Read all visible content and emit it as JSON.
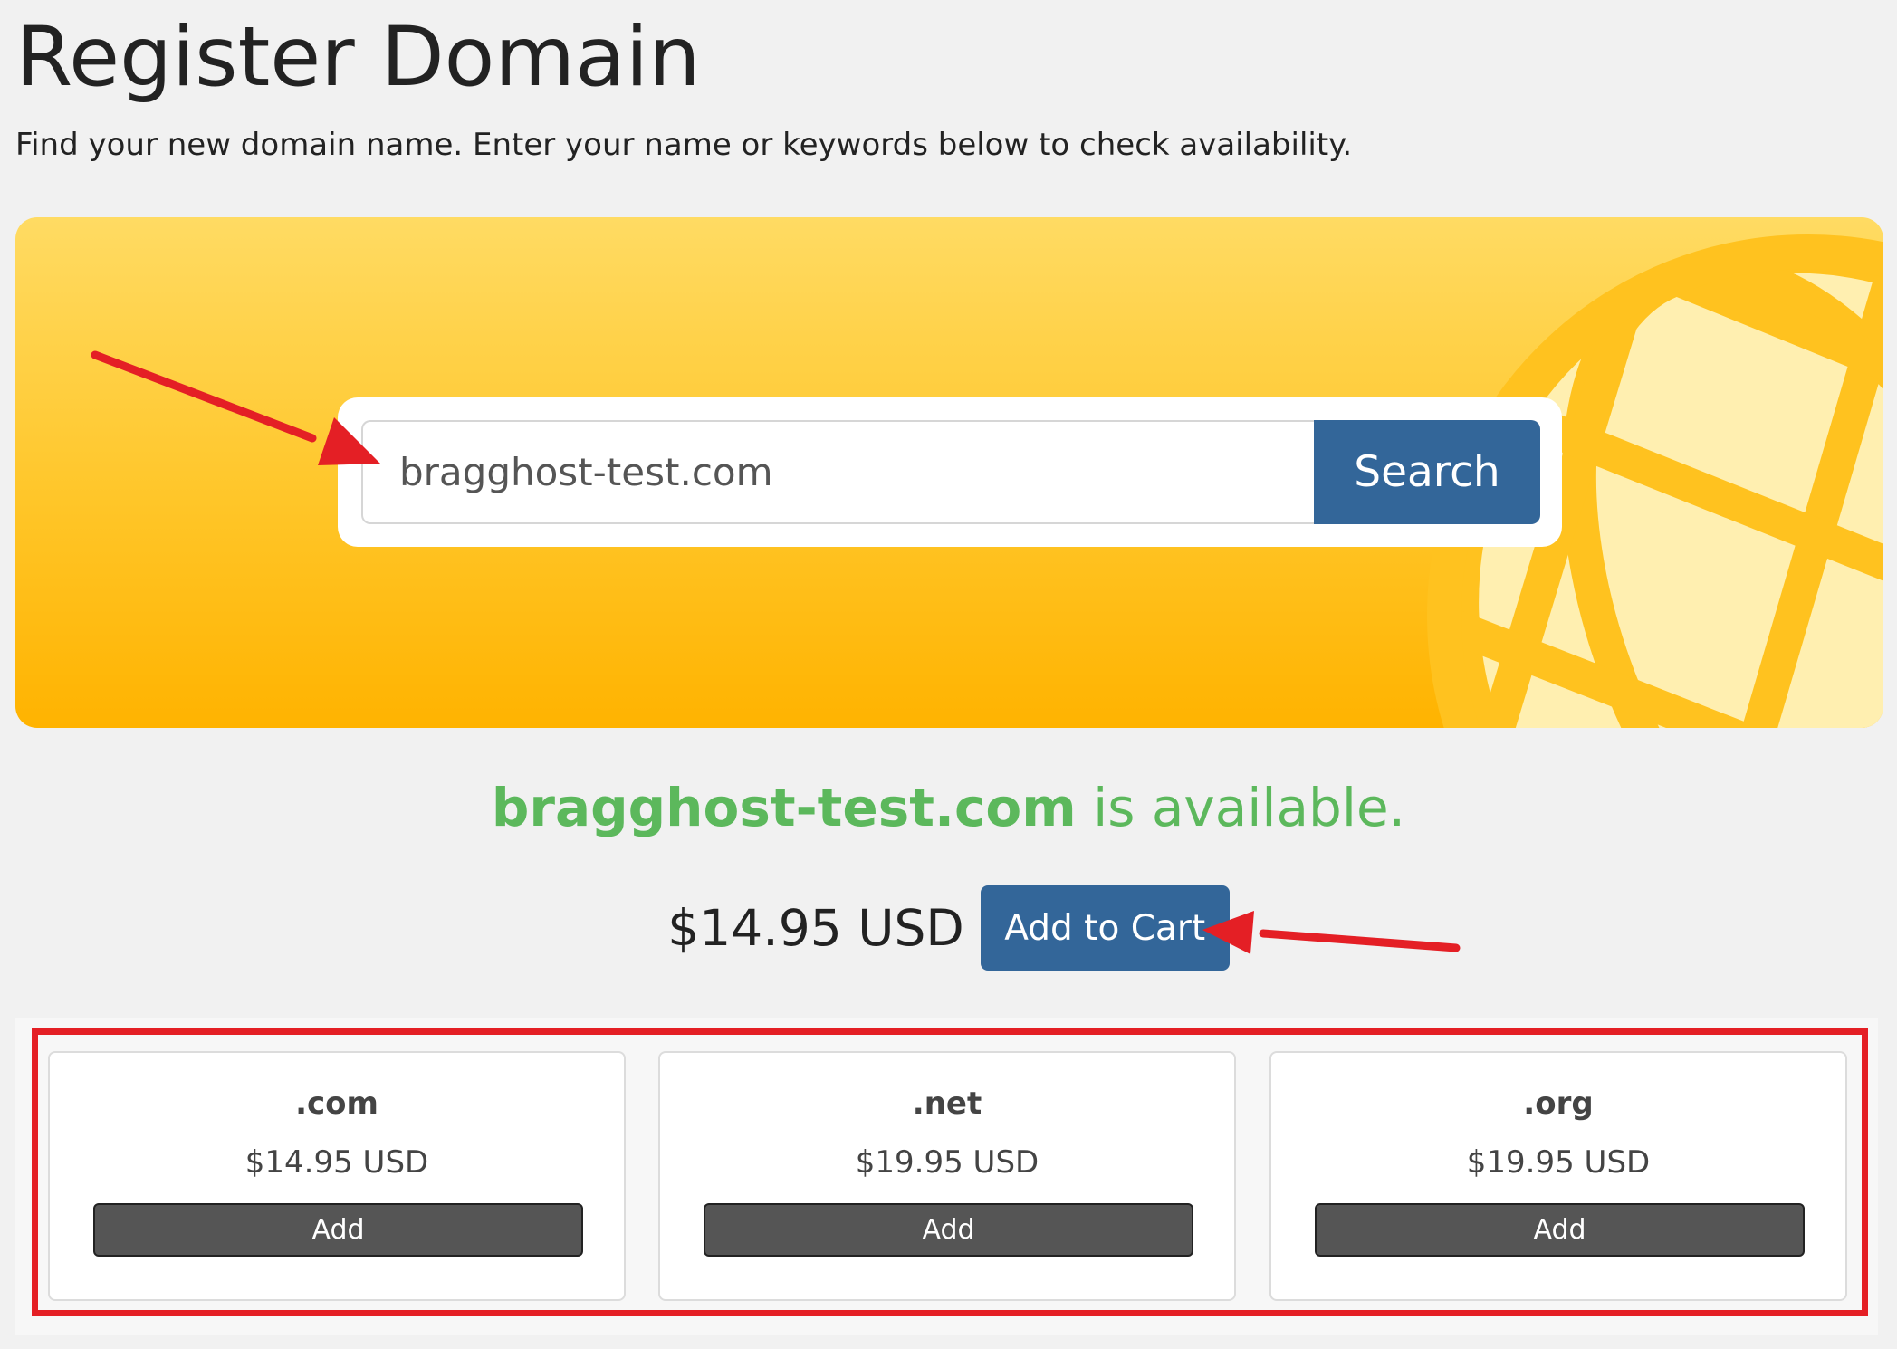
{
  "page": {
    "title": "Register Domain",
    "subtitle": "Find your new domain name. Enter your name or keywords below to check availability."
  },
  "search": {
    "value": "bragghost-test.com",
    "button_label": "Search"
  },
  "result": {
    "domain": "bragghost-test.com",
    "status_text": " is available.",
    "price": "$14.95 USD",
    "add_to_cart_label": "Add to Cart"
  },
  "suggestions": [
    {
      "tld": ".com",
      "price": "$14.95 USD",
      "button_label": "Add"
    },
    {
      "tld": ".net",
      "price": "$19.95 USD",
      "button_label": "Add"
    },
    {
      "tld": ".org",
      "price": "$19.95 USD",
      "button_label": "Add"
    }
  ],
  "colors": {
    "hero_gradient_top": "#ffdb63",
    "hero_gradient_bottom": "#ffb300",
    "primary_button": "#336699",
    "available_green": "#5cb85c",
    "tld_button": "#555555",
    "annotation_red": "#e41f25"
  },
  "icons": {
    "hero_background": "globe-icon",
    "annotations": "red-arrow-icon"
  }
}
